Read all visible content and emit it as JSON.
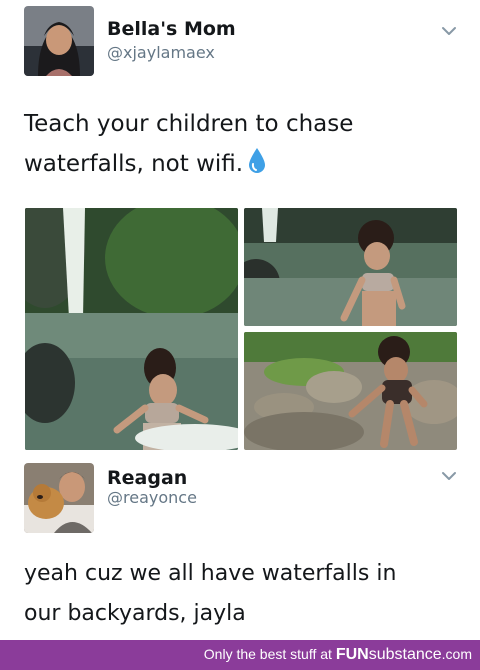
{
  "tweet_1": {
    "author_name": "Bella's Mom",
    "author_handle": "@xjaylamaex",
    "text_line_1": "Teach your children to chase",
    "text_line_2": "waterfalls, not wifi.",
    "emoji_icon": "water-drop-icon",
    "photos": [
      "waterfall-child-photo",
      "child-in-river-photo",
      "child-on-rocks-photo"
    ]
  },
  "tweet_2": {
    "author_name": "Reagan",
    "author_handle": "@reayonce",
    "text_line_1": "yeah cuz we all have waterfalls in",
    "text_line_2": "our backyards, jayla"
  },
  "footer": {
    "prefix": "Only the best stuff at",
    "brand_bold": "FUN",
    "brand_rest": "substance",
    "domain": ".com"
  },
  "colors": {
    "footer_bg": "#8b3c9a",
    "handle_gray": "#657786",
    "drop_blue": "#3fa0e6"
  }
}
